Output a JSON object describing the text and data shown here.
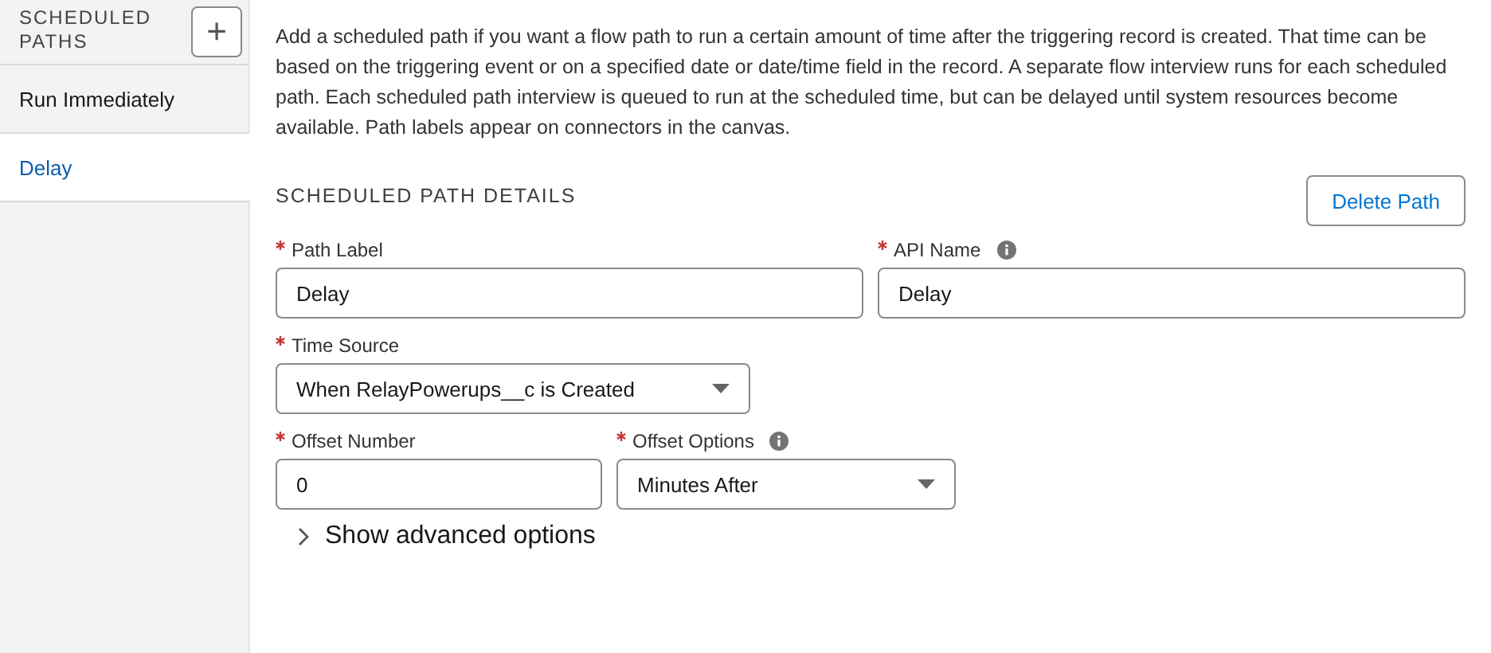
{
  "sidebar": {
    "title": "SCHEDULED PATHS",
    "add_button": "+",
    "items": [
      {
        "label": "Run Immediately",
        "selected": false
      },
      {
        "label": "Delay",
        "selected": true
      }
    ]
  },
  "description": "Add a scheduled path if you want a flow path to run a certain amount of time after the triggering record is created. That time can be based on the triggering event or on a specified date or date/time field in the record. A separate flow interview runs for each scheduled path. Each scheduled path interview is queued to run at the scheduled time, but can be delayed until system resources become available. Path labels appear on connectors in the canvas.",
  "section_title": "SCHEDULED PATH DETAILS",
  "delete_button": "Delete Path",
  "field_rows": [
    [
      {
        "kind": "text",
        "label": "Path Label",
        "required": true,
        "help": false,
        "value": "Delay"
      },
      {
        "kind": "text",
        "label": "API Name",
        "required": true,
        "help": true,
        "value": "Delay"
      }
    ],
    [
      {
        "kind": "select",
        "label": "Time Source",
        "required": true,
        "help": false,
        "value": "When RelayPowerups__c is Created"
      }
    ],
    [
      {
        "kind": "text",
        "label": "Offset Number",
        "required": true,
        "help": false,
        "value": "0"
      },
      {
        "kind": "select",
        "label": "Offset Options",
        "required": true,
        "help": true,
        "value": "Minutes After"
      }
    ]
  ],
  "advanced_toggle": {
    "label": "Show advanced options",
    "expanded": false
  }
}
